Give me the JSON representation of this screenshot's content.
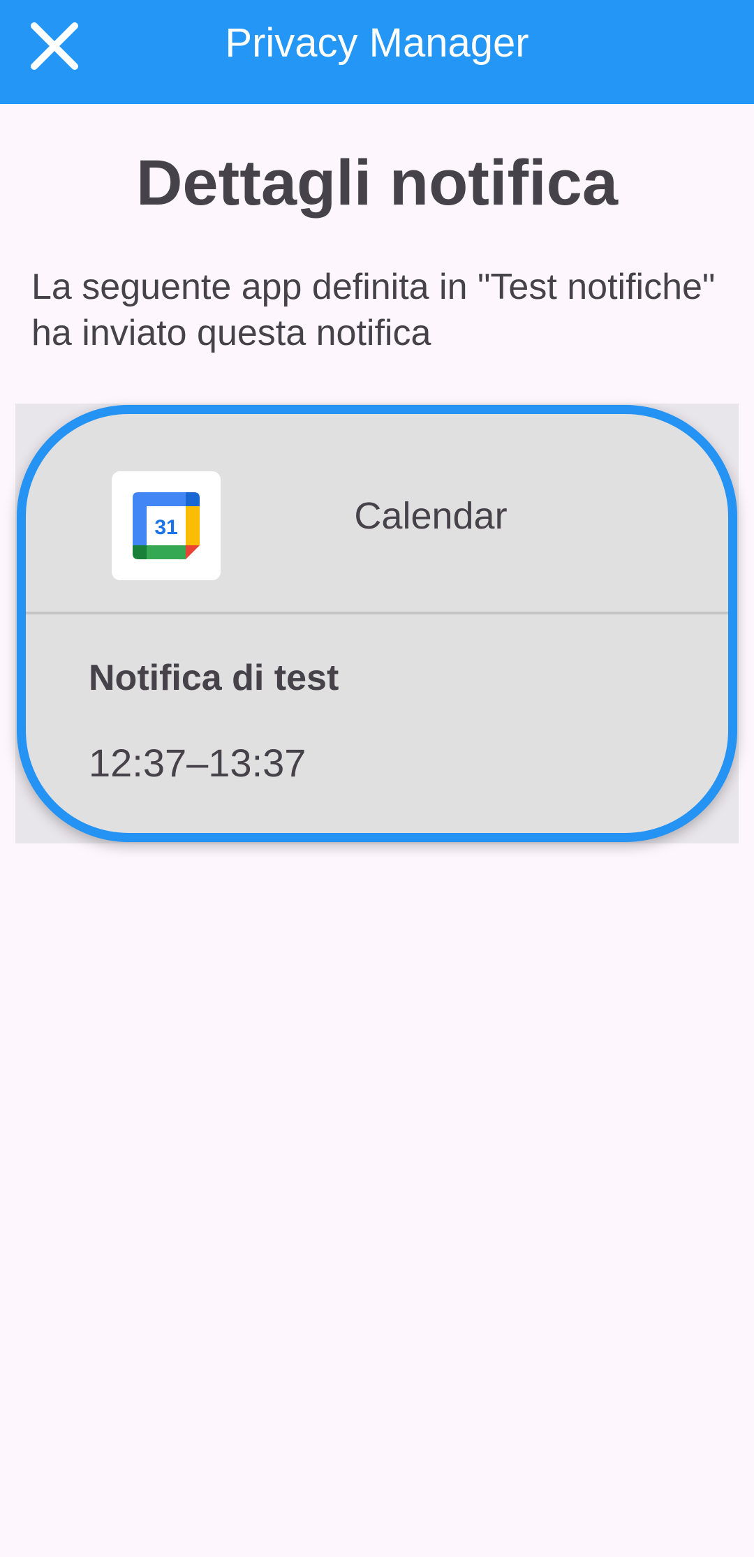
{
  "appbar": {
    "title": "Privacy Manager",
    "close_icon": "close-icon",
    "color": "#2396f6"
  },
  "page": {
    "title": "Dettagli notifica",
    "description": "La seguente app definita in \"Test notifiche\" ha inviato questa notifica"
  },
  "notification_card": {
    "app_icon": "google-calendar-icon",
    "app_icon_text": "31",
    "app_name": "Calendar",
    "notification_title": "Notifica di test",
    "notification_time": "12:37–13:37",
    "border_color": "#2593f3"
  }
}
